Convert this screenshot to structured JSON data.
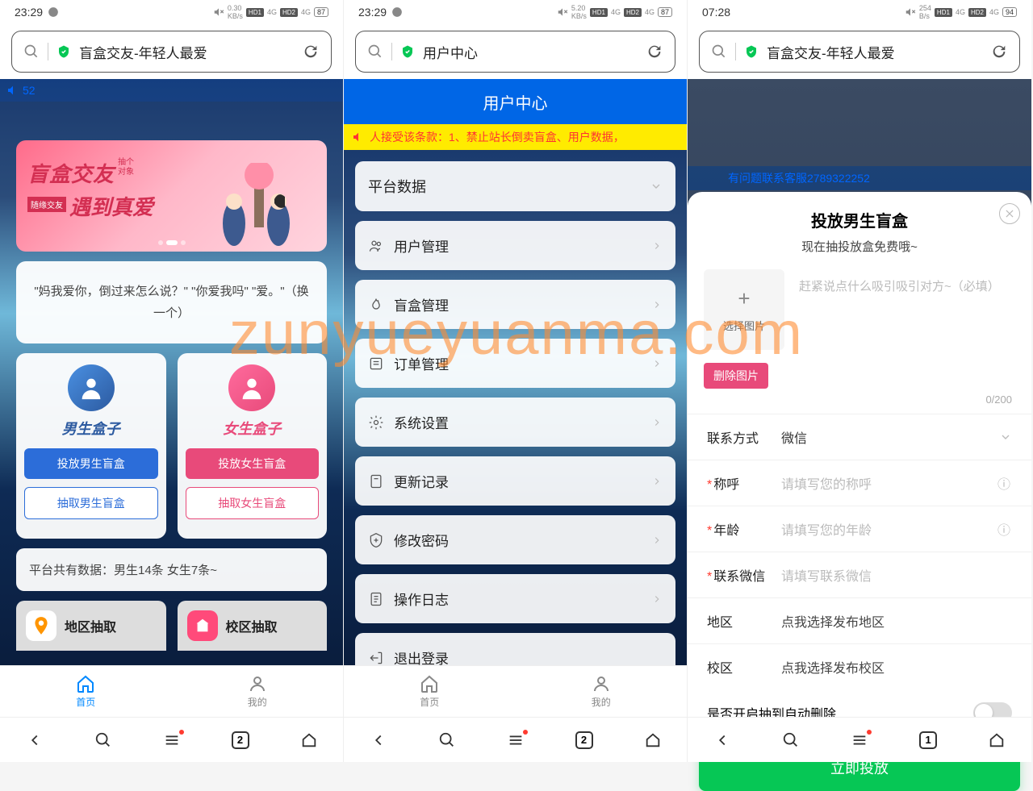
{
  "watermark": "zunyueyuanma.com",
  "screens": {
    "s1": {
      "time": "23:29",
      "url": "盲盒交友-年轻人最爱",
      "notice": "52",
      "banner": {
        "line1": "盲盒交友",
        "sub1": "抽个",
        "sub2": "对象",
        "pre2": "随缘交友",
        "line2": "遇到真爱"
      },
      "quote": "\"妈我爱你，倒过来怎么说？\" \"你爱我吗\" \"爱。\"（换一个）",
      "male": {
        "title": "男生盒子",
        "btn1": "投放男生盲盒",
        "btn2": "抽取男生盲盒"
      },
      "female": {
        "title": "女生盒子",
        "btn1": "投放女生盲盒",
        "btn2": "抽取女生盲盒"
      },
      "stats": "平台共有数据：男生14条 女生7条~",
      "extract1": "地区抽取",
      "extract2": "校区抽取",
      "tab1": "首页",
      "tab2": "我的"
    },
    "s2": {
      "time": "23:29",
      "url": "用户中心",
      "header": "用户中心",
      "notice": "人接受该条款：1、禁止站长倒卖盲盒、用户数据，",
      "items": [
        "平台数据",
        "用户管理",
        "盲盒管理",
        "订单管理",
        "系统设置",
        "更新记录",
        "修改密码",
        "操作日志",
        "退出登录"
      ],
      "tab1": "首页",
      "tab2": "我的"
    },
    "s3": {
      "time": "07:28",
      "url": "盲盒交友-年轻人最爱",
      "bg_notice": "有问题联系客服2789322252",
      "title": "投放男生盲盒",
      "sub": "现在抽投放盒免费哦~",
      "upload": "选择图片",
      "hint": "赶紧说点什么吸引吸引对方~（必填）",
      "del": "删除图片",
      "count": "0/200",
      "fields": {
        "contact": {
          "label": "联系方式",
          "value": "微信"
        },
        "name": {
          "label": "称呼",
          "placeholder": "请填写您的称呼"
        },
        "age": {
          "label": "年龄",
          "placeholder": "请填写您的年龄"
        },
        "wx": {
          "label": "联系微信",
          "placeholder": "请填写联系微信"
        },
        "region": {
          "label": "地区",
          "placeholder": "点我选择发布地区"
        },
        "campus": {
          "label": "校区",
          "placeholder": "点我选择发布校区"
        }
      },
      "toggle": "是否开启抽到自动删除",
      "submit": "立即投放",
      "nav_badge": "1"
    }
  },
  "nav_badge_default": "2"
}
